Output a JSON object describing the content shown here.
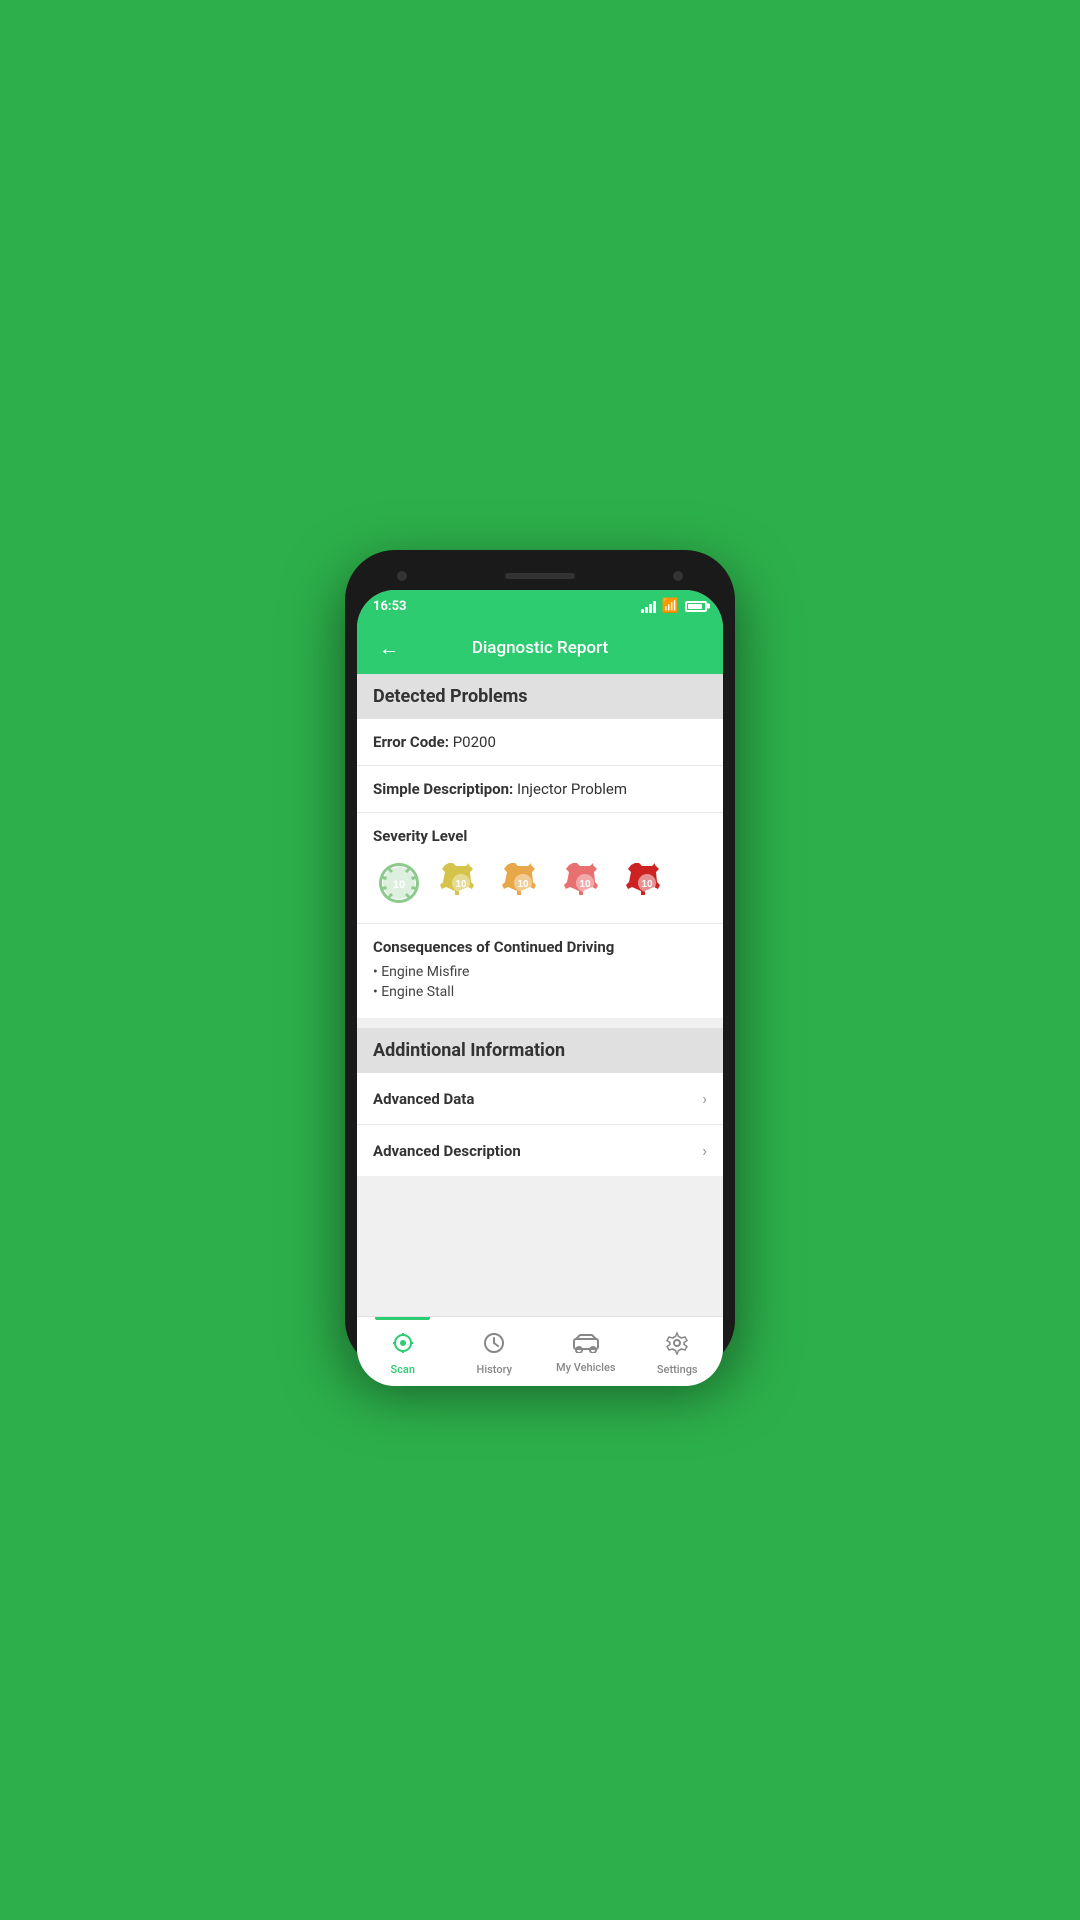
{
  "statusBar": {
    "time": "16:53"
  },
  "header": {
    "back_label": "←",
    "title": "Diagnostic Report"
  },
  "detectedProblems": {
    "sectionTitle": "Detected Problems",
    "errorCodeLabel": "Error Code:",
    "errorCodeValue": "P0200",
    "simpleDescLabel": "Simple Descriptipon:",
    "simpleDescValue": "Injector Problem",
    "severityLabel": "Severity Level",
    "consequences": {
      "title": "Consequences of Continued Driving",
      "items": [
        "• Engine Misfire",
        "• Engine Stall"
      ]
    }
  },
  "additionalInfo": {
    "sectionTitle": "Addintional Information",
    "items": [
      {
        "label": "Advanced Data"
      },
      {
        "label": "Advanced Description"
      }
    ]
  },
  "bottomNav": {
    "items": [
      {
        "id": "scan",
        "label": "Scan",
        "active": true
      },
      {
        "id": "history",
        "label": "History",
        "active": false
      },
      {
        "id": "my-vehicles",
        "label": "My Vehicles",
        "active": false
      },
      {
        "id": "settings",
        "label": "Settings",
        "active": false
      }
    ]
  },
  "severity": {
    "colors": [
      "#8ec98e",
      "#d4c44a",
      "#e8a84a",
      "#e87070",
      "#cc2222"
    ],
    "count": 5,
    "active": 5
  }
}
